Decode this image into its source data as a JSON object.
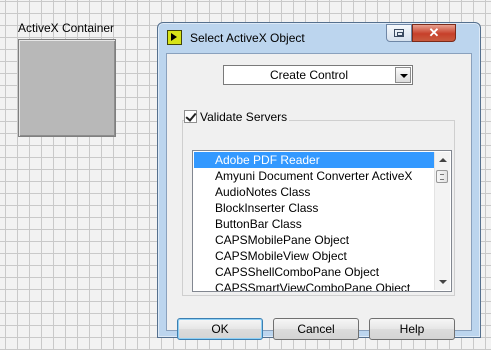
{
  "canvas": {
    "control_label": "ActiveX Container"
  },
  "dialog": {
    "title": "Select ActiveX Object",
    "icon": "labview-icon",
    "mode_select": {
      "value": "Create Control"
    },
    "validate_servers": {
      "label": "Validate Servers",
      "checked": true
    },
    "list": {
      "selected_index": 0,
      "items": [
        "Adobe PDF Reader",
        "Amyuni Document Converter ActiveX",
        "AudioNotes Class",
        "BlockInserter Class",
        "ButtonBar Class",
        "CAPSMobilePane Object",
        "CAPSMobileView Object",
        "CAPSShellComboPane Object",
        "CAPSSmartViewComboPane Object"
      ]
    },
    "buttons": {
      "ok": "OK",
      "cancel": "Cancel",
      "help": "Help"
    },
    "titlebar_buttons": {
      "restore_icon": "restore-icon",
      "close_icon": "close-icon",
      "close_glyph": "✕"
    }
  },
  "colors": {
    "selection": "#3399ff",
    "close_button": "#c7402a",
    "frame": "#bcd5ee"
  }
}
